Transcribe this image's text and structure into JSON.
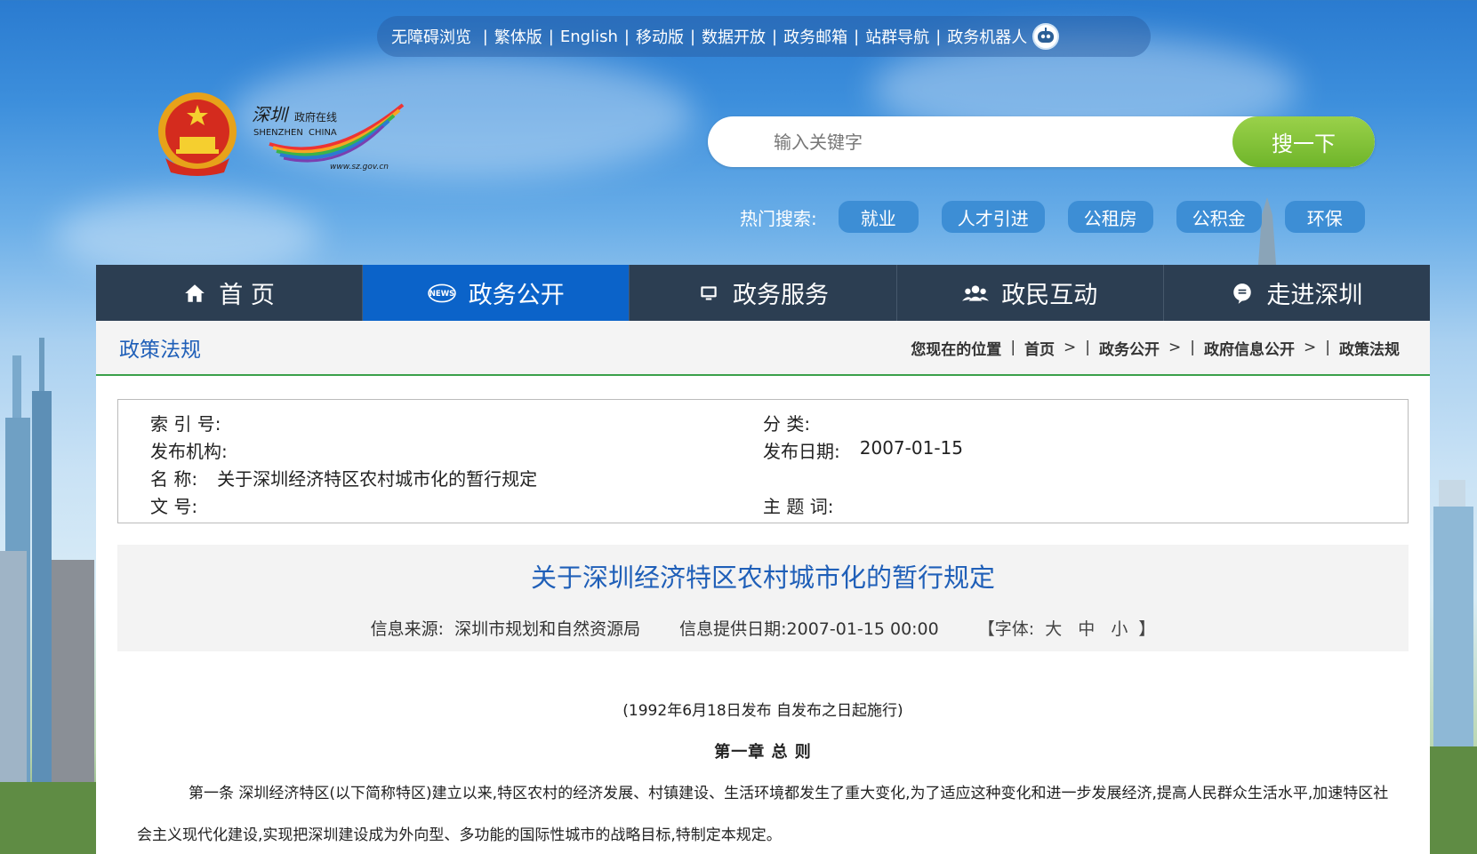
{
  "top_links": [
    "无障碍浏览",
    "繁体版",
    "English",
    "移动版",
    "数据开放",
    "政务邮箱",
    "站群导航",
    "政务机器人"
  ],
  "logo": {
    "cn": "深圳政府在线",
    "en": "SHENZHEN CHINA",
    "url": "www.sz.gov.cn"
  },
  "search": {
    "placeholder": "输入关键字",
    "button": "搜一下"
  },
  "hot_search": {
    "label": "热门搜索:",
    "tags": [
      "就业",
      "人才引进",
      "公租房",
      "公积金",
      "环保"
    ]
  },
  "nav": [
    {
      "label": "首 页",
      "icon": "home-icon"
    },
    {
      "label": "政务公开",
      "icon": "news-icon",
      "active": true
    },
    {
      "label": "政务服务",
      "icon": "monitor-icon"
    },
    {
      "label": "政民互动",
      "icon": "people-icon"
    },
    {
      "label": "走进深圳",
      "icon": "chat-icon"
    }
  ],
  "section_title": "政策法规",
  "breadcrumb": {
    "prefix": "您现在的位置",
    "items": [
      "首页",
      "政务公开",
      "政府信息公开",
      "政策法规"
    ]
  },
  "meta": {
    "index_no_label": "索 引 号:",
    "index_no": "",
    "category_label": "分 类:",
    "category": "",
    "publisher_label": "发布机构:",
    "publisher": "",
    "date_label": "发布日期:",
    "date": "2007-01-15",
    "name_label": "名 称:",
    "name": "关于深圳经济特区农村城市化的暂行规定",
    "doc_no_label": "文 号:",
    "doc_no": "",
    "subject_label": "主 题 词:",
    "subject": ""
  },
  "article": {
    "title": "关于深圳经济特区农村城市化的暂行规定",
    "source_label": "信息来源:",
    "source": "深圳市规划和自然资源局",
    "provided_label": "信息提供日期:",
    "provided": "2007-01-15 00:00",
    "font_label": "【字体:",
    "font_large": "大",
    "font_medium": "中",
    "font_small": "小",
    "font_end": "】",
    "issued": "(1992年6月18日发布 自发布之日起施行)",
    "chapter": "第一章 总 则",
    "paragraph1": "第一条 深圳经济特区(以下简称特区)建立以来,特区农村的经济发展、村镇建设、生活环境都发生了重大变化,为了适应这种变化和进一步发展经济,提高人民群众生活水平,加速特区社会主义现代化建设,实现把深圳建设成为外向型、多功能的国际性城市的战略目标,特制定本规定。"
  },
  "colors": {
    "nav_bg": "#2c3e52",
    "nav_active": "#0b63c9",
    "search_btn": "#7cbf32",
    "link_blue": "#1f5fb8",
    "accent_green": "#3aa04a"
  }
}
